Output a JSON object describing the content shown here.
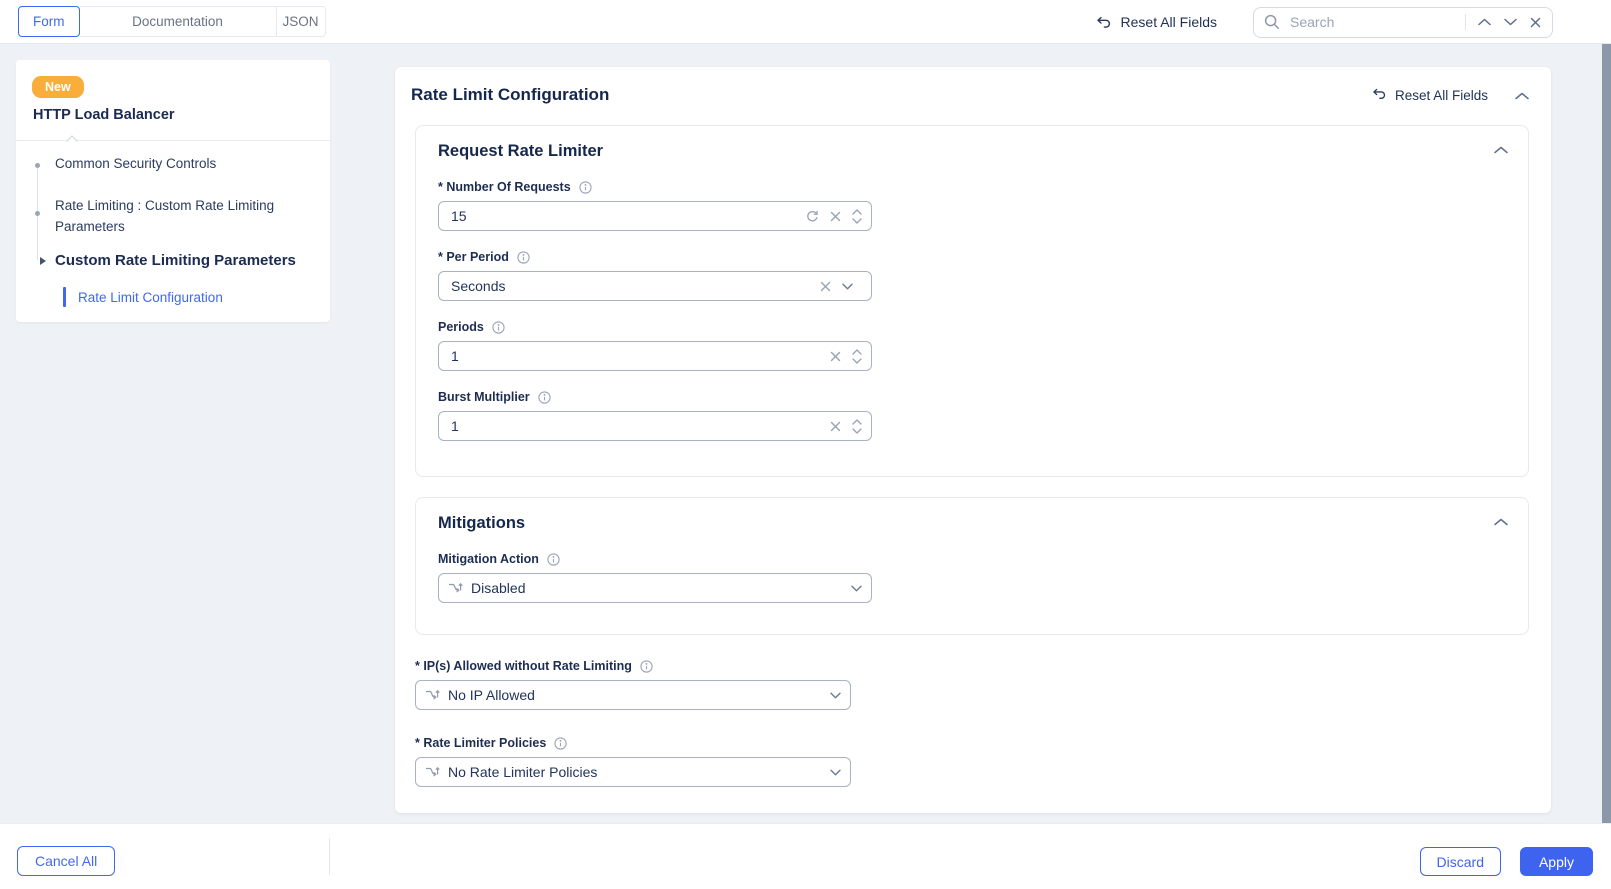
{
  "topbar": {
    "tabs": [
      {
        "label": "Form",
        "active": true
      },
      {
        "label": "Documentation",
        "active": false
      },
      {
        "label": "JSON",
        "active": false
      }
    ],
    "reset_all_label": "Reset All Fields",
    "search": {
      "placeholder": "Search"
    }
  },
  "sidebar": {
    "badge": "New",
    "title": "HTTP Load Balancer",
    "items": [
      {
        "label": "Common Security Controls",
        "active": false
      },
      {
        "label": "Rate Limiting : Custom Rate Limiting Parameters",
        "active": false
      },
      {
        "label": "Custom Rate Limiting Parameters",
        "active": false
      },
      {
        "label": "Rate Limit Configuration",
        "active": true
      }
    ]
  },
  "panel": {
    "title": "Rate Limit Configuration",
    "reset_all_label": "Reset All Fields",
    "request_rate_limiter": {
      "title": "Request Rate Limiter",
      "number_of_requests": {
        "label": "* Number Of Requests",
        "value": "15"
      },
      "per_period": {
        "label": "* Per Period",
        "value": "Seconds"
      },
      "periods": {
        "label": "Periods",
        "value": "1"
      },
      "burst_multiplier": {
        "label": "Burst Multiplier",
        "value": "1"
      }
    },
    "mitigations": {
      "title": "Mitigations",
      "mitigation_action": {
        "label": "Mitigation Action",
        "value": "Disabled"
      }
    },
    "ips_allowed": {
      "label": "* IP(s) Allowed without Rate Limiting",
      "value": "No IP Allowed"
    },
    "rate_limiter_policies": {
      "label": "* Rate Limiter Policies",
      "value": "No Rate Limiter Policies"
    }
  },
  "footer": {
    "cancel_all_label": "Cancel All",
    "discard_label": "Discard",
    "apply_label": "Apply"
  },
  "colors": {
    "accent_blue": "#3E63EE",
    "badge_orange": "#F9AD3B",
    "heading_navy": "#15274D",
    "icon_gray": "#97A2B4",
    "scrollbar_slate": "#8C97A9",
    "page_bg": "#EEF1F5"
  },
  "icons": {
    "undo-icon": "↩",
    "search-icon": "🔍",
    "chevron-up-icon": "⌃",
    "chevron-down-icon": "⌄",
    "close-icon": "×",
    "info-icon": "ⓘ",
    "refresh-icon": "↻",
    "number-stepper-icon": "⌃⌄",
    "split-arrow-icon": "⑂",
    "collapse-icon": "⌃",
    "caret-right-icon": "▸",
    "bullet-icon": "•"
  }
}
